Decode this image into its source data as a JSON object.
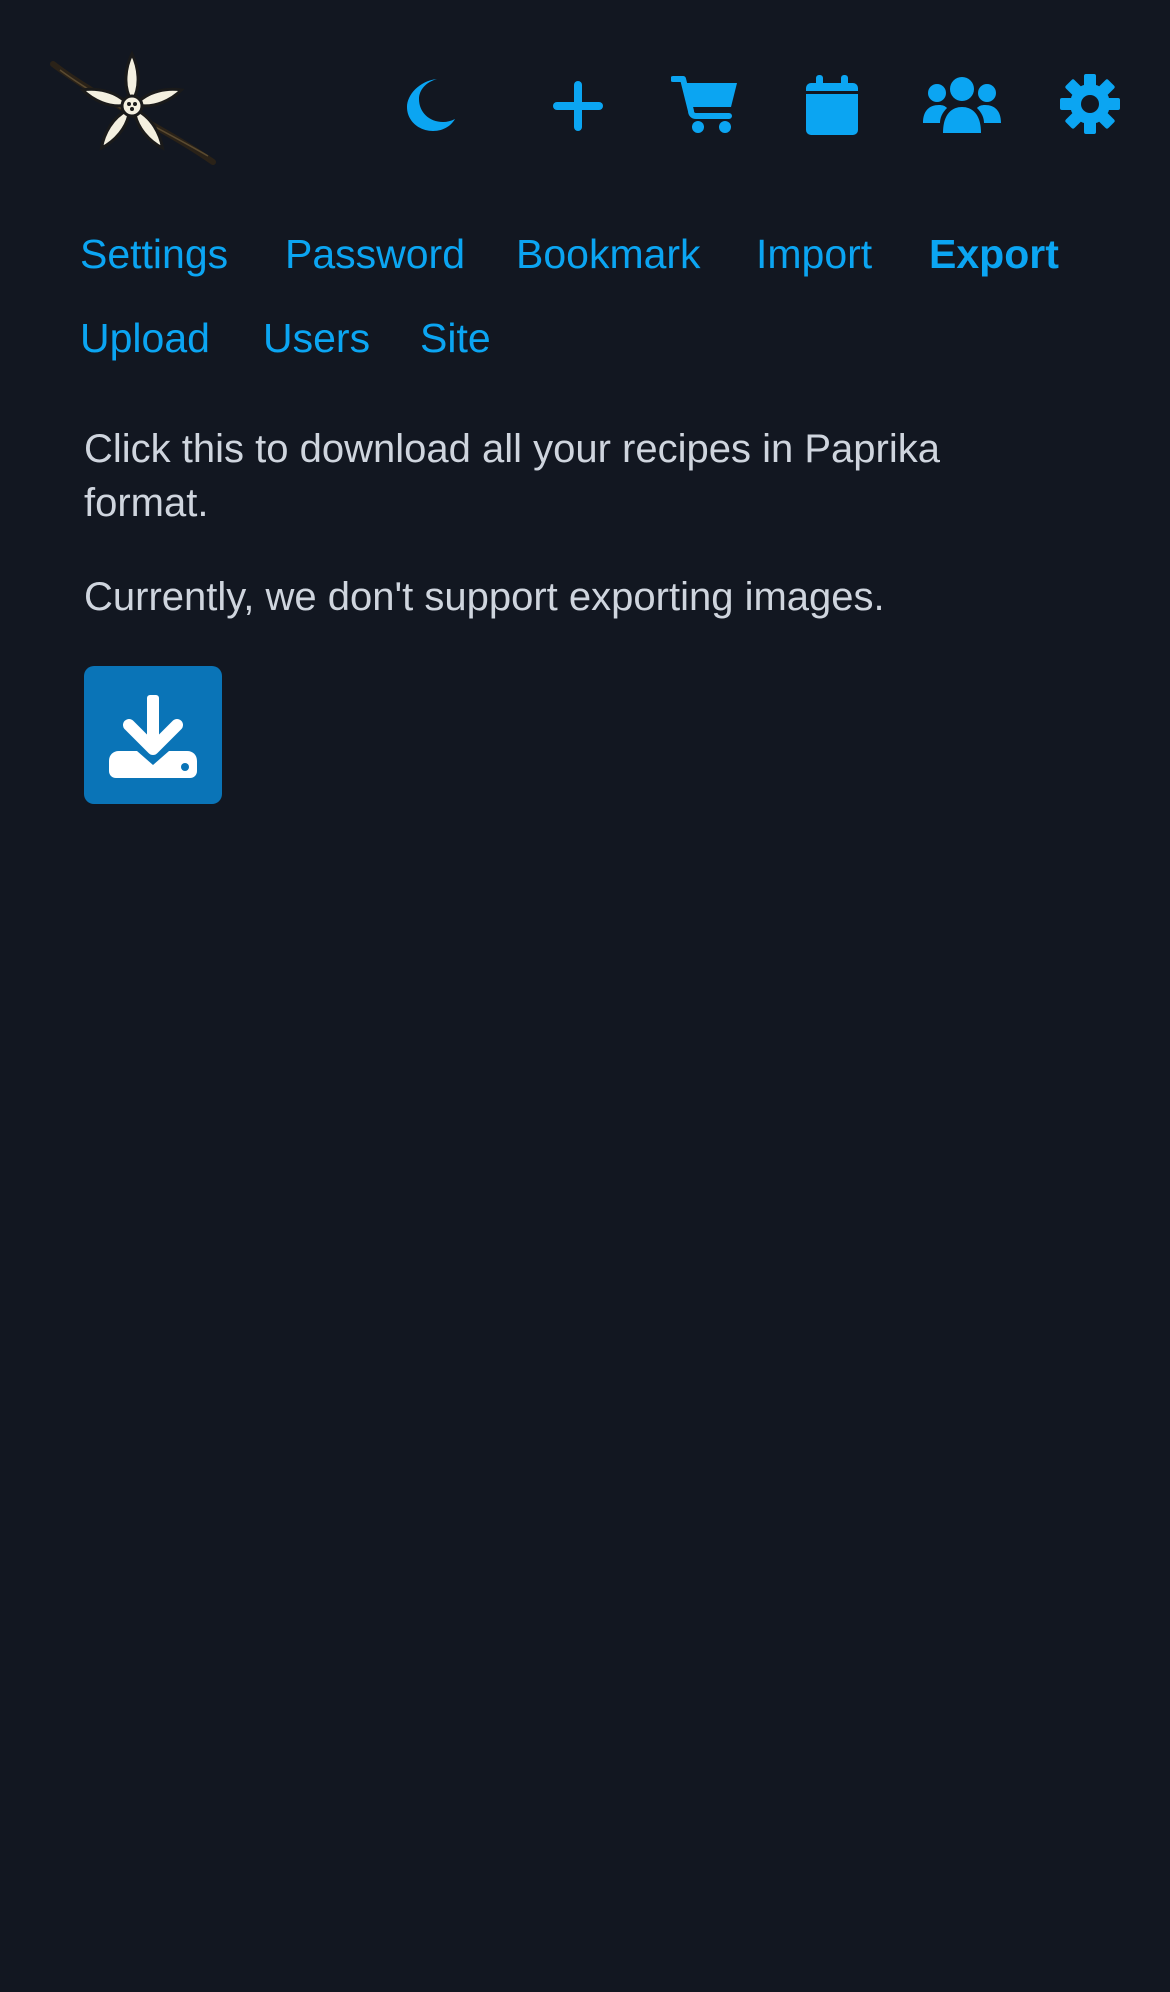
{
  "header": {
    "logo": "flower-logo",
    "icons": [
      {
        "name": "moon-icon",
        "label": "Toggle dark mode"
      },
      {
        "name": "plus-icon",
        "label": "Add recipe"
      },
      {
        "name": "cart-icon",
        "label": "Shopping cart"
      },
      {
        "name": "calendar-icon",
        "label": "Calendar"
      },
      {
        "name": "users-icon",
        "label": "Users"
      },
      {
        "name": "gear-icon",
        "label": "Settings"
      }
    ],
    "accent_color": "#0ba5f2"
  },
  "tabs": {
    "items": [
      {
        "label": "Settings"
      },
      {
        "label": "Password"
      },
      {
        "label": "Bookmark"
      },
      {
        "label": "Import"
      },
      {
        "label": "Export"
      },
      {
        "label": "Upload"
      },
      {
        "label": "Users"
      },
      {
        "label": "Site"
      }
    ],
    "active": "Export"
  },
  "main": {
    "description": "Click this to download all your recipes in Paprika format.",
    "note": "Currently, we don't support exporting images.",
    "download_button": {
      "icon": "download-icon",
      "color": "#0a74b7"
    }
  },
  "colors": {
    "background": "#121721",
    "text": "#cfd5de"
  }
}
